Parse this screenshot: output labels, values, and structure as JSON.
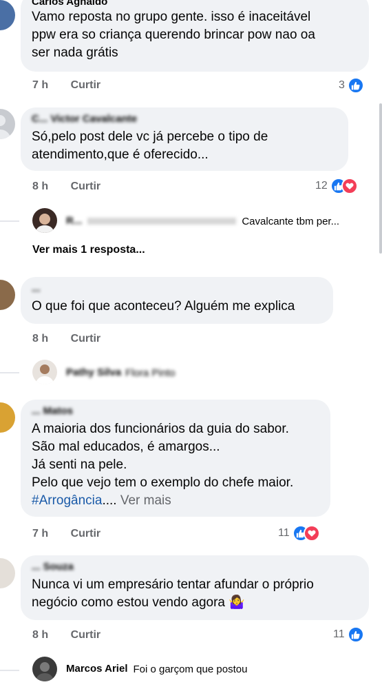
{
  "comments": [
    {
      "author": "Carlos Agnaldo",
      "lines": [
        "Vamo reposta no grupo gente. isso é inaceitável",
        "ppw era so criança querendo brincar pow nao oa",
        "ser nada grátis"
      ],
      "time": "7 h",
      "like_label": "Curtir",
      "reaction_count": "3"
    },
    {
      "author": "C... Victor Cavalcante",
      "lines": [
        "Só,pelo post dele vc já percebe o tipo de",
        "atendimento,que é oferecido..."
      ],
      "time": "8 h",
      "like_label": "Curtir",
      "reaction_count": "12",
      "reply_preview": {
        "author": "R...",
        "text": "Cavalcante tbm per..."
      },
      "view_more": "Ver mais 1 resposta..."
    },
    {
      "author": "...",
      "lines": [
        "O que foi que aconteceu? Alguém me explica"
      ],
      "time": "8 h",
      "like_label": "Curtir",
      "reply_preview": {
        "author": "Pathy Silva",
        "text": "Flora Pinto"
      }
    },
    {
      "author": "... Matos",
      "lines": [
        "A maioria dos funcionários da guia do sabor.",
        "São mal educados, é amargos...",
        "Já senti na pele.",
        "Pelo que vejo tem o exemplo do chefe maior."
      ],
      "hashtag": "#Arrogância",
      "ellipsis": "....",
      "see_more": "Ver mais",
      "time": "7 h",
      "like_label": "Curtir",
      "reaction_count": "11"
    },
    {
      "author": "... Souza",
      "lines": [
        "Nunca vi um empresário tentar afundar o próprio",
        "negócio como estou vendo agora 🤷‍♀️"
      ],
      "time": "8 h",
      "like_label": "Curtir",
      "reaction_count": "11",
      "reply_preview": {
        "author": "Marcos Ariel",
        "text": "Foi o garçom que postou"
      }
    }
  ]
}
